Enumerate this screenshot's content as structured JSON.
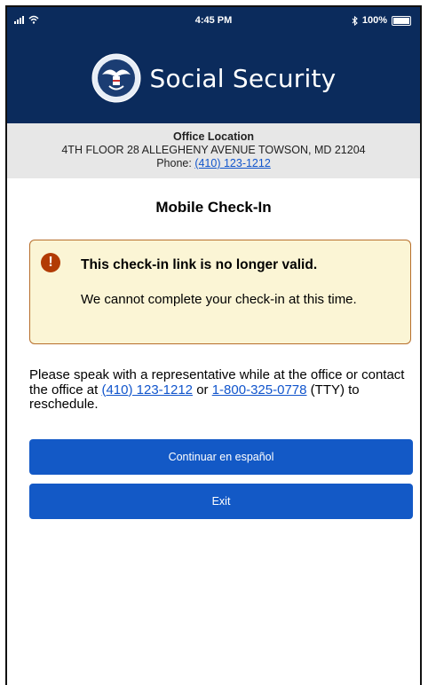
{
  "status_bar": {
    "time": "4:45 PM",
    "bluetooth_icon": "bluetooth-icon",
    "battery": "100%"
  },
  "header": {
    "brand_name": "Social Security",
    "logo_icon": "ssa-seal-icon",
    "background_color": "#0b2b5c"
  },
  "office": {
    "title": "Office Location",
    "address": "4TH FLOOR 28 ALLEGHENY AVENUE TOWSON, MD 21204",
    "phone_label": "Phone:",
    "phone": "(410) 123-1212"
  },
  "page": {
    "heading": "Mobile Check-In"
  },
  "alert": {
    "icon": "exclamation-icon",
    "title": "This check-in link is no longer valid.",
    "message": "We cannot complete your check-in at this time.",
    "border_color": "#b76f2c",
    "background_color": "#fbf5d5"
  },
  "info": {
    "text_1": "Please speak with a representative while at the office or contact the office at",
    "phone": "(410) 123-1212",
    "text_2": "or",
    "tty_phone": "1-800-325-0778",
    "text_3": "(TTY) to reschedule."
  },
  "buttons": {
    "spanish_label": "Continuar en español",
    "exit_label": "Exit",
    "color": "#1359c6"
  }
}
